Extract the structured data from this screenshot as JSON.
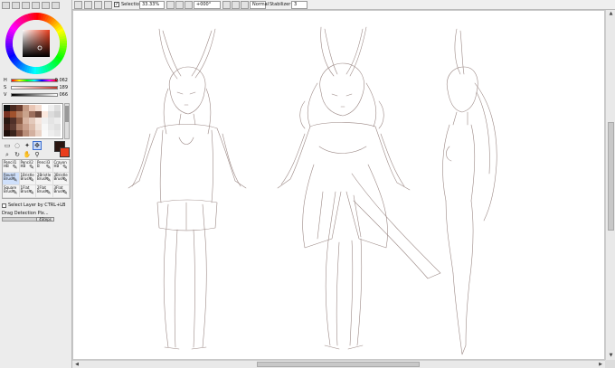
{
  "colors": {
    "fg": "#2a1510",
    "bg": "#ea3d1c",
    "accent": "#3c6fd1",
    "line": "#8a7470"
  },
  "sliders": [
    {
      "label": "H",
      "value": "0.062"
    },
    {
      "label": "S",
      "value": "189"
    },
    {
      "label": "V",
      "value": "066"
    }
  ],
  "palette": [
    "#111111",
    "#4a2a20",
    "#6a3d2e",
    "#c49a84",
    "#e9c6b5",
    "#f3dcd0",
    "#ffffff",
    "#efefef",
    "#dddddd",
    "#7a3324",
    "#a0522d",
    "#b07d62",
    "#c9a38c",
    "#9c6f5d",
    "#6e4a3e",
    "#fbe8de",
    "#dcdcdc",
    "#d0d0d0",
    "#2b1a14",
    "#503028",
    "#8b5a43",
    "#d7b3a0",
    "#e3c9bb",
    "#f6e7df",
    "#f0f0f0",
    "#e4e4e4",
    "#ececec",
    "#3f1f19",
    "#5e3b31",
    "#ab7d67",
    "#caa08c",
    "#dcbcab",
    "#efe0d7",
    "#f7f7f7",
    "#e8e8e8",
    "#e0e0e0",
    "#1e0f0b",
    "#3a241c",
    "#7d4e3d",
    "#b98e79",
    "#d3b09f",
    "#ead3c6",
    "#fafafa",
    "#eeeeee",
    "#e6e6e6"
  ],
  "tools": [
    {
      "name": "rect-select-icon",
      "glyph": "▭"
    },
    {
      "name": "lasso-icon",
      "glyph": "◌"
    },
    {
      "name": "magic-wand-icon",
      "glyph": "✦"
    },
    {
      "name": "move-icon",
      "glyph": "✥",
      "active": true
    },
    {
      "name": "zoom-icon",
      "glyph": "⌕"
    },
    {
      "name": "rotate-icon",
      "glyph": "↻"
    },
    {
      "name": "hand-icon",
      "glyph": "✋"
    },
    {
      "name": "eyedropper-icon",
      "glyph": "⚲"
    }
  ],
  "brushes": [
    {
      "label": "Pencil1 HB",
      "icon": "✎"
    },
    {
      "label": "Pencil2 HB",
      "icon": "✎"
    },
    {
      "label": "Pencil3 B",
      "icon": "✎"
    },
    {
      "label": "Crayon HB",
      "icon": "✎"
    },
    {
      "label": "Round Brush",
      "icon": "✎",
      "selected": true
    },
    {
      "label": "1Bristle Brush",
      "icon": "✎"
    },
    {
      "label": "2Bristle Brush",
      "icon": "✎"
    },
    {
      "label": "3Bristle Brush",
      "icon": "✎"
    },
    {
      "label": "Square Brush",
      "icon": "✎"
    },
    {
      "label": "1Flat Brush",
      "icon": "✎"
    },
    {
      "label": "2Flat Brush",
      "icon": "✎"
    },
    {
      "label": "3Flat Brush",
      "icon": "✎"
    }
  ],
  "options": {
    "select_layer": "Select Layer by CTRL+LB",
    "drag_detection": "Drag Detection Pix...",
    "drag_value": "4Steps"
  },
  "toolbar": {
    "selection_label": "Selection",
    "zoom": "33.33%",
    "rotation": "+000°",
    "blend_mode": "Normal",
    "stabilizer_label": "Stabilizer",
    "stabilizer_value": "3"
  }
}
